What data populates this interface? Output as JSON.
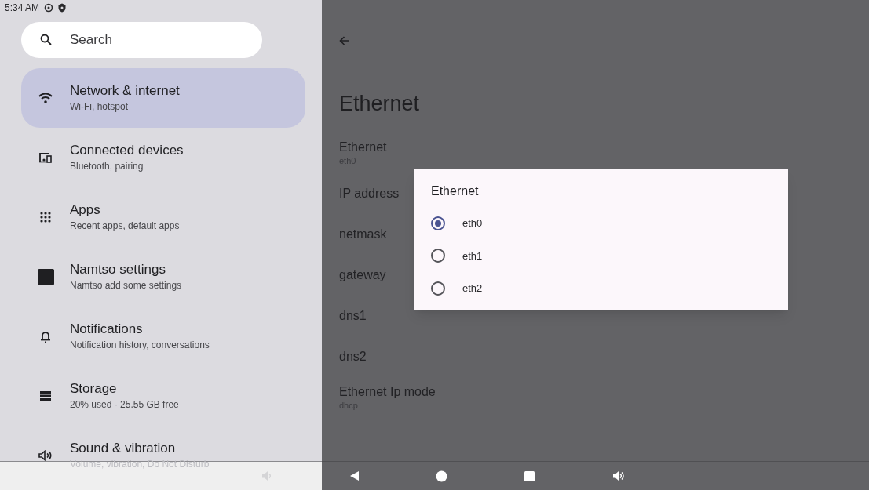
{
  "status_bar": {
    "time": "5:34 AM"
  },
  "search": {
    "placeholder": "Search"
  },
  "sidebar": {
    "items": [
      {
        "kind": "wifi",
        "title": "Network & internet",
        "subtitle": "Wi-Fi, hotspot",
        "selected": true
      },
      {
        "kind": "devices",
        "title": "Connected devices",
        "subtitle": "Bluetooth, pairing",
        "selected": false
      },
      {
        "kind": "apps",
        "title": "Apps",
        "subtitle": "Recent apps, default apps",
        "selected": false
      },
      {
        "kind": "square",
        "title": "Namtso settings",
        "subtitle": "Namtso add some settings",
        "selected": false
      },
      {
        "kind": "bell",
        "title": "Notifications",
        "subtitle": "Notification history, conversations",
        "selected": false
      },
      {
        "kind": "storage",
        "title": "Storage",
        "subtitle": "20% used - 25.55 GB free",
        "selected": false
      },
      {
        "kind": "sound",
        "title": "Sound & vibration",
        "subtitle": "Volume, vibration, Do Not Disturb",
        "selected": false
      }
    ]
  },
  "page": {
    "title": "Ethernet",
    "items": [
      {
        "title": "Ethernet",
        "subtitle": "eth0"
      },
      {
        "title": "IP address"
      },
      {
        "title": "netmask"
      },
      {
        "title": "gateway"
      },
      {
        "title": "dns1"
      },
      {
        "title": "dns2"
      },
      {
        "title": "Ethernet Ip mode",
        "subtitle": "dhcp"
      }
    ]
  },
  "dialog": {
    "title": "Ethernet",
    "options": [
      {
        "label": "eth0",
        "selected": true
      },
      {
        "label": "eth1",
        "selected": false
      },
      {
        "label": "eth2",
        "selected": false
      }
    ]
  }
}
